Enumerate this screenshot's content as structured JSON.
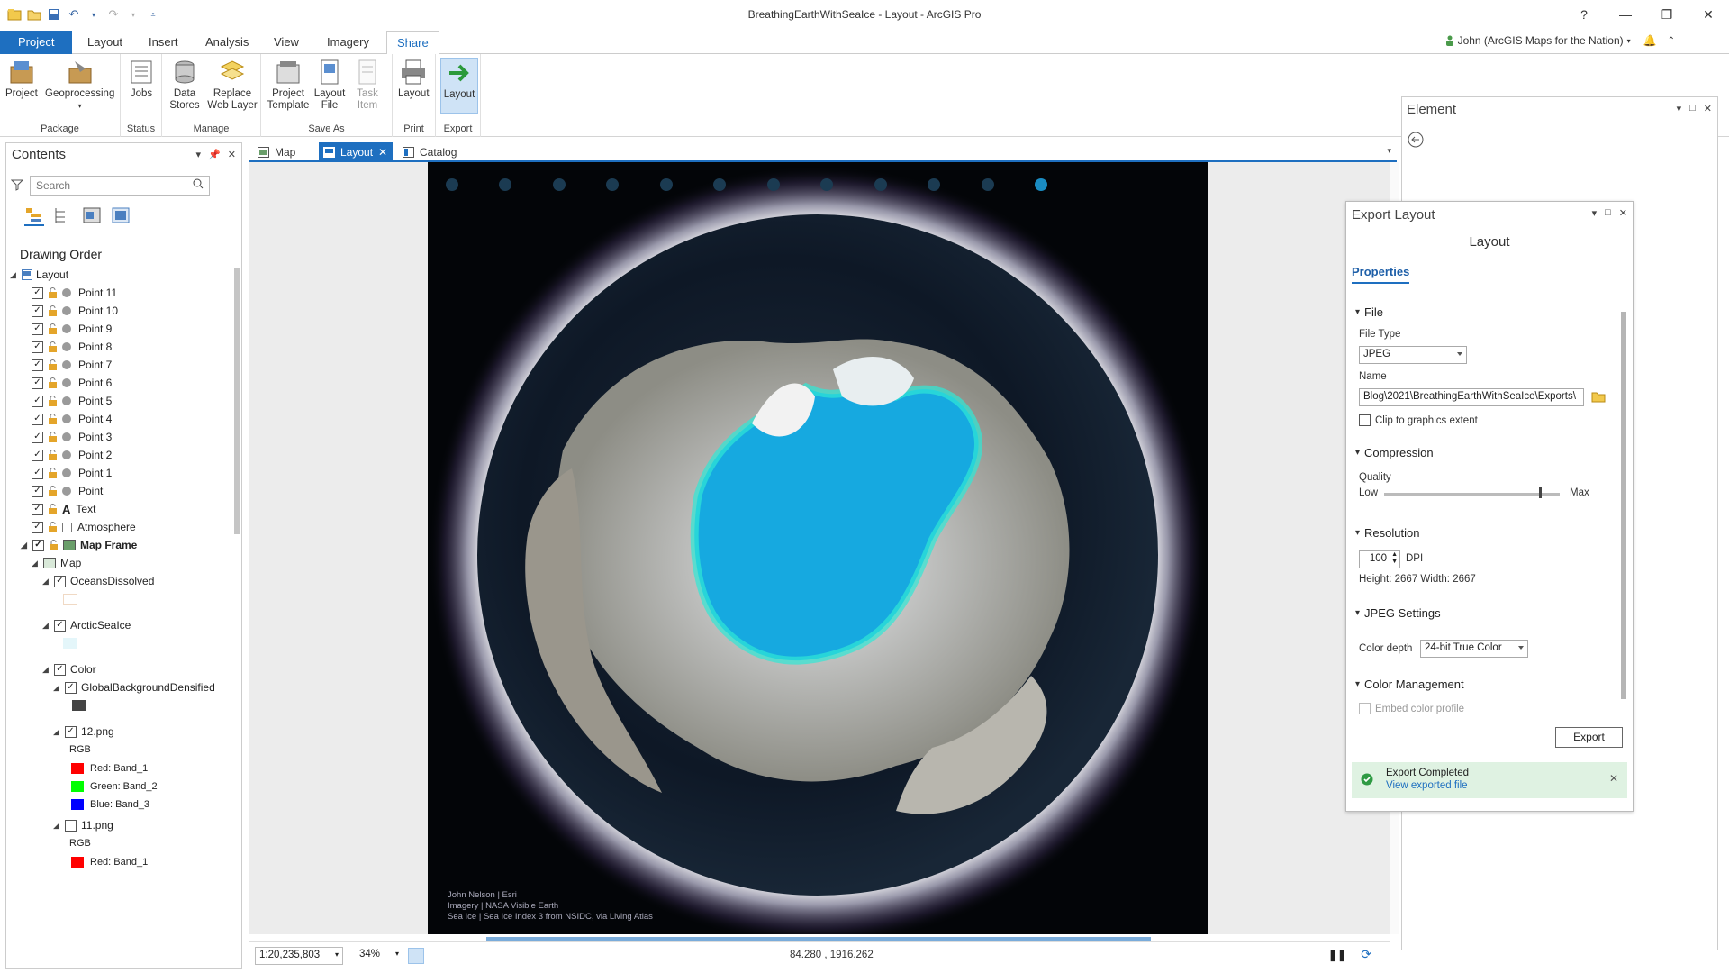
{
  "window": {
    "title": "BreathingEarthWithSeaIce - Layout - ArcGIS Pro",
    "help": "?",
    "minimize": "—",
    "restore": "❐",
    "close": "✕"
  },
  "ribbon": {
    "tabs": [
      "Project",
      "Layout",
      "Insert",
      "Analysis",
      "View",
      "Imagery",
      "Share"
    ],
    "active_tab": "Share",
    "user": "John (ArcGIS Maps for the Nation)",
    "groups": [
      {
        "label": "Package",
        "buttons": [
          "Project",
          "Geoprocessing"
        ]
      },
      {
        "label": "Status",
        "buttons": [
          "Jobs"
        ]
      },
      {
        "label": "Manage",
        "buttons": [
          "Data Stores",
          "Replace Web Layer"
        ]
      },
      {
        "label": "Save As",
        "buttons": [
          "Project Template",
          "Layout File",
          "Task Item"
        ]
      },
      {
        "label": "Print",
        "buttons": [
          "Layout"
        ]
      },
      {
        "label": "Export",
        "buttons": [
          "Layout"
        ]
      }
    ]
  },
  "contents": {
    "title": "Contents",
    "search_placeholder": "Search",
    "heading": "Drawing Order",
    "items": [
      {
        "label": "Layout"
      },
      {
        "label": "Point 11"
      },
      {
        "label": "Point 10"
      },
      {
        "label": "Point 9"
      },
      {
        "label": "Point 8"
      },
      {
        "label": "Point 7"
      },
      {
        "label": "Point 6"
      },
      {
        "label": "Point 5"
      },
      {
        "label": "Point 4"
      },
      {
        "label": "Point 3"
      },
      {
        "label": "Point 2"
      },
      {
        "label": "Point 1"
      },
      {
        "label": "Point"
      },
      {
        "label": "Text"
      },
      {
        "label": "Atmosphere"
      },
      {
        "label": "Map Frame"
      },
      {
        "label": "Map"
      },
      {
        "label": "OceansDissolved"
      },
      {
        "label": "ArcticSeaIce"
      },
      {
        "label": "Color"
      },
      {
        "label": "GlobalBackgroundDensified"
      },
      {
        "label": "12.png"
      },
      {
        "label": "RGB"
      },
      {
        "label": "Red:  Band_1"
      },
      {
        "label": "Green: Band_2"
      },
      {
        "label": "Blue:  Band_3"
      },
      {
        "label": "11.png"
      },
      {
        "label": "RGB"
      },
      {
        "label": "Red:  Band_1"
      }
    ]
  },
  "doc_tabs": [
    "Map",
    "Layout",
    "Catalog"
  ],
  "active_doc_tab": "Layout",
  "layout": {
    "credits": [
      "John Nelson | Esri",
      "Imagery | NASA Visible Earth",
      "Sea Ice | Sea Ice Index 3 from NSIDC, via Living Atlas"
    ]
  },
  "status": {
    "scale": "1:20,235,803",
    "zoom": "34%",
    "coords": "84.280 , 1916.262"
  },
  "element_pane": {
    "title": "Element"
  },
  "export_pane": {
    "title": "Export Layout",
    "subtitle": "Layout",
    "tab": "Properties",
    "sections": {
      "file": "File",
      "compression": "Compression",
      "resolution": "Resolution",
      "jpeg": "JPEG Settings",
      "color_mgmt": "Color Management"
    },
    "file_type_label": "File Type",
    "file_type": "JPEG",
    "name_label": "Name",
    "name_value": "Blog\\2021\\BreathingEarthWithSeaIce\\Exports\\",
    "clip_label": "Clip to graphics extent",
    "quality_label": "Quality",
    "quality_low": "Low",
    "quality_max": "Max",
    "quality_level": 0.88,
    "dpi_value": "100",
    "dpi_label": "DPI",
    "size_text": "Height: 2667  Width: 2667",
    "color_depth_label": "Color depth",
    "color_depth": "24-bit True Color",
    "embed_label": "Embed color profile",
    "export_button": "Export",
    "toast_title": "Export Completed",
    "toast_link": "View exported file"
  }
}
